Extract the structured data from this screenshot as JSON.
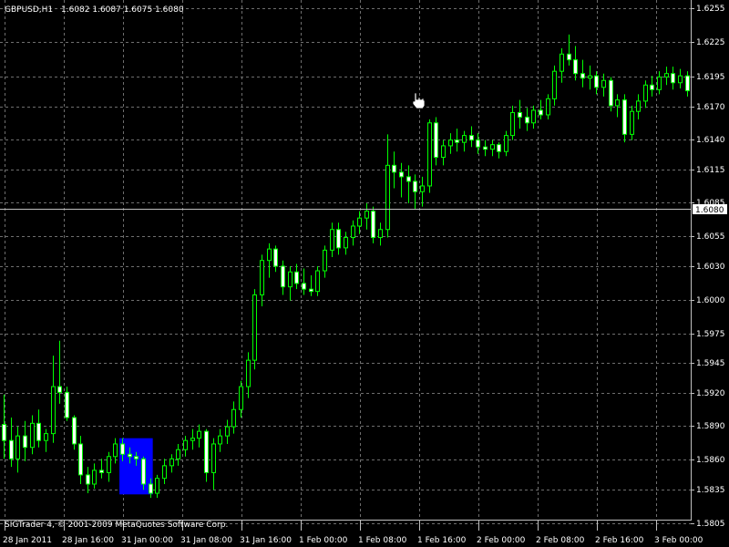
{
  "header": {
    "symbol": "GBPUSD,H1",
    "ohlc": "1.6082 1.6087 1.6075 1.6080"
  },
  "footer": {
    "copyright": "SIGTrader 4, © 2001-2009 MetaQuotes Software Corp."
  },
  "colors": {
    "background": "#000000",
    "grid": "#6e6e6e",
    "candle": "#00ff00",
    "bear_body": "#ffffff",
    "highlight": "#0000ff",
    "price_line": "#c0c0c0"
  },
  "chart_data": {
    "type": "candlestick",
    "title": "GBPUSD,H1",
    "ylim": [
      1.5805,
      1.6255
    ],
    "y_ticks": [
      "1.6255",
      "1.6225",
      "1.6195",
      "1.6170",
      "1.6140",
      "1.6115",
      "1.6085",
      "1.6055",
      "1.6030",
      "1.6000",
      "1.5975",
      "1.5945",
      "1.5920",
      "1.5890",
      "1.5860",
      "1.5835",
      "1.5805"
    ],
    "current_price": "1.6080",
    "x_ticks": [
      "28 Jan 2011",
      "28 Jan 16:00",
      "31 Jan 00:00",
      "31 Jan 08:00",
      "31 Jan 16:00",
      "1 Feb 00:00",
      "1 Feb 08:00",
      "1 Feb 16:00",
      "2 Feb 00:00",
      "2 Feb 08:00",
      "2 Feb 16:00",
      "3 Feb 00:00"
    ],
    "highlight_range": {
      "from_bar": 17,
      "to_bar": 21,
      "low": 1.5831,
      "high": 1.588
    },
    "candles": [
      {
        "o": 1.5892,
        "h": 1.5918,
        "l": 1.5862,
        "c": 1.5878
      },
      {
        "o": 1.5878,
        "h": 1.5898,
        "l": 1.5855,
        "c": 1.5862
      },
      {
        "o": 1.5862,
        "h": 1.589,
        "l": 1.585,
        "c": 1.5882
      },
      {
        "o": 1.5882,
        "h": 1.5895,
        "l": 1.586,
        "c": 1.5872
      },
      {
        "o": 1.5872,
        "h": 1.59,
        "l": 1.5866,
        "c": 1.5893
      },
      {
        "o": 1.5893,
        "h": 1.5905,
        "l": 1.5872,
        "c": 1.5878
      },
      {
        "o": 1.5878,
        "h": 1.5888,
        "l": 1.5868,
        "c": 1.5884
      },
      {
        "o": 1.5884,
        "h": 1.5952,
        "l": 1.5876,
        "c": 1.5925
      },
      {
        "o": 1.5925,
        "h": 1.5965,
        "l": 1.591,
        "c": 1.592
      },
      {
        "o": 1.592,
        "h": 1.5925,
        "l": 1.5895,
        "c": 1.5898
      },
      {
        "o": 1.5898,
        "h": 1.59,
        "l": 1.587,
        "c": 1.5875
      },
      {
        "o": 1.5875,
        "h": 1.5882,
        "l": 1.584,
        "c": 1.5848
      },
      {
        "o": 1.5848,
        "h": 1.5855,
        "l": 1.5832,
        "c": 1.584
      },
      {
        "o": 1.584,
        "h": 1.5858,
        "l": 1.5836,
        "c": 1.5852
      },
      {
        "o": 1.5852,
        "h": 1.5862,
        "l": 1.5845,
        "c": 1.585
      },
      {
        "o": 1.585,
        "h": 1.5868,
        "l": 1.5842,
        "c": 1.5864
      },
      {
        "o": 1.5864,
        "h": 1.588,
        "l": 1.5858,
        "c": 1.5875
      },
      {
        "o": 1.5875,
        "h": 1.588,
        "l": 1.586,
        "c": 1.5866
      },
      {
        "o": 1.5866,
        "h": 1.5872,
        "l": 1.5858,
        "c": 1.5864
      },
      {
        "o": 1.5864,
        "h": 1.5868,
        "l": 1.5856,
        "c": 1.5862
      },
      {
        "o": 1.5862,
        "h": 1.5864,
        "l": 1.5835,
        "c": 1.584
      },
      {
        "o": 1.584,
        "h": 1.5845,
        "l": 1.5828,
        "c": 1.5832
      },
      {
        "o": 1.5832,
        "h": 1.5848,
        "l": 1.5828,
        "c": 1.5845
      },
      {
        "o": 1.5845,
        "h": 1.5862,
        "l": 1.584,
        "c": 1.5856
      },
      {
        "o": 1.5856,
        "h": 1.5866,
        "l": 1.585,
        "c": 1.5862
      },
      {
        "o": 1.5862,
        "h": 1.5875,
        "l": 1.5856,
        "c": 1.587
      },
      {
        "o": 1.587,
        "h": 1.5882,
        "l": 1.5864,
        "c": 1.5878
      },
      {
        "o": 1.5878,
        "h": 1.5888,
        "l": 1.587,
        "c": 1.588
      },
      {
        "o": 1.588,
        "h": 1.5892,
        "l": 1.5872,
        "c": 1.5886
      },
      {
        "o": 1.5886,
        "h": 1.5888,
        "l": 1.5842,
        "c": 1.585
      },
      {
        "o": 1.585,
        "h": 1.588,
        "l": 1.5835,
        "c": 1.5875
      },
      {
        "o": 1.5875,
        "h": 1.5888,
        "l": 1.5868,
        "c": 1.5882
      },
      {
        "o": 1.5882,
        "h": 1.5896,
        "l": 1.5875,
        "c": 1.589
      },
      {
        "o": 1.589,
        "h": 1.5912,
        "l": 1.5884,
        "c": 1.5905
      },
      {
        "o": 1.5905,
        "h": 1.593,
        "l": 1.5898,
        "c": 1.5925
      },
      {
        "o": 1.5925,
        "h": 1.5955,
        "l": 1.5915,
        "c": 1.5948
      },
      {
        "o": 1.5948,
        "h": 1.601,
        "l": 1.594,
        "c": 1.6005
      },
      {
        "o": 1.6005,
        "h": 1.604,
        "l": 1.5995,
        "c": 1.6035
      },
      {
        "o": 1.6035,
        "h": 1.605,
        "l": 1.602,
        "c": 1.6045
      },
      {
        "o": 1.6045,
        "h": 1.6048,
        "l": 1.6025,
        "c": 1.603
      },
      {
        "o": 1.603,
        "h": 1.6035,
        "l": 1.6005,
        "c": 1.6012
      },
      {
        "o": 1.6012,
        "h": 1.603,
        "l": 1.6,
        "c": 1.6025
      },
      {
        "o": 1.6025,
        "h": 1.6032,
        "l": 1.601,
        "c": 1.6015
      },
      {
        "o": 1.6015,
        "h": 1.6028,
        "l": 1.6005,
        "c": 1.601
      },
      {
        "o": 1.601,
        "h": 1.6022,
        "l": 1.6004,
        "c": 1.6008
      },
      {
        "o": 1.6008,
        "h": 1.603,
        "l": 1.6004,
        "c": 1.6026
      },
      {
        "o": 1.6026,
        "h": 1.6048,
        "l": 1.602,
        "c": 1.6044
      },
      {
        "o": 1.6044,
        "h": 1.6068,
        "l": 1.6038,
        "c": 1.6062
      },
      {
        "o": 1.6062,
        "h": 1.6068,
        "l": 1.604,
        "c": 1.6046
      },
      {
        "o": 1.6046,
        "h": 1.606,
        "l": 1.604,
        "c": 1.6055
      },
      {
        "o": 1.6055,
        "h": 1.607,
        "l": 1.6048,
        "c": 1.6065
      },
      {
        "o": 1.6065,
        "h": 1.6078,
        "l": 1.6058,
        "c": 1.6072
      },
      {
        "o": 1.6072,
        "h": 1.6085,
        "l": 1.6062,
        "c": 1.6078
      },
      {
        "o": 1.6078,
        "h": 1.6082,
        "l": 1.605,
        "c": 1.6055
      },
      {
        "o": 1.6055,
        "h": 1.6068,
        "l": 1.6048,
        "c": 1.6062
      },
      {
        "o": 1.6062,
        "h": 1.6145,
        "l": 1.6055,
        "c": 1.6118
      },
      {
        "o": 1.6118,
        "h": 1.613,
        "l": 1.6098,
        "c": 1.6112
      },
      {
        "o": 1.6112,
        "h": 1.612,
        "l": 1.609,
        "c": 1.6108
      },
      {
        "o": 1.6108,
        "h": 1.6118,
        "l": 1.6085,
        "c": 1.6104
      },
      {
        "o": 1.6104,
        "h": 1.611,
        "l": 1.608,
        "c": 1.6095
      },
      {
        "o": 1.6095,
        "h": 1.6108,
        "l": 1.6082,
        "c": 1.61
      },
      {
        "o": 1.61,
        "h": 1.6158,
        "l": 1.6094,
        "c": 1.6155
      },
      {
        "o": 1.6155,
        "h": 1.616,
        "l": 1.6118,
        "c": 1.6125
      },
      {
        "o": 1.6125,
        "h": 1.614,
        "l": 1.6118,
        "c": 1.6135
      },
      {
        "o": 1.6135,
        "h": 1.6146,
        "l": 1.6128,
        "c": 1.614
      },
      {
        "o": 1.614,
        "h": 1.615,
        "l": 1.613,
        "c": 1.6138
      },
      {
        "o": 1.6138,
        "h": 1.6148,
        "l": 1.613,
        "c": 1.6144
      },
      {
        "o": 1.6144,
        "h": 1.6152,
        "l": 1.6134,
        "c": 1.614
      },
      {
        "o": 1.614,
        "h": 1.6146,
        "l": 1.6128,
        "c": 1.6134
      },
      {
        "o": 1.6134,
        "h": 1.614,
        "l": 1.6126,
        "c": 1.6132
      },
      {
        "o": 1.6132,
        "h": 1.614,
        "l": 1.6126,
        "c": 1.6136
      },
      {
        "o": 1.6136,
        "h": 1.6138,
        "l": 1.6124,
        "c": 1.613
      },
      {
        "o": 1.613,
        "h": 1.6148,
        "l": 1.6126,
        "c": 1.6144
      },
      {
        "o": 1.6144,
        "h": 1.617,
        "l": 1.614,
        "c": 1.6164
      },
      {
        "o": 1.6164,
        "h": 1.6175,
        "l": 1.615,
        "c": 1.616
      },
      {
        "o": 1.616,
        "h": 1.6168,
        "l": 1.6148,
        "c": 1.6155
      },
      {
        "o": 1.6155,
        "h": 1.617,
        "l": 1.615,
        "c": 1.6166
      },
      {
        "o": 1.6166,
        "h": 1.6175,
        "l": 1.6158,
        "c": 1.6162
      },
      {
        "o": 1.6162,
        "h": 1.618,
        "l": 1.6158,
        "c": 1.6176
      },
      {
        "o": 1.6176,
        "h": 1.6205,
        "l": 1.617,
        "c": 1.62
      },
      {
        "o": 1.62,
        "h": 1.622,
        "l": 1.619,
        "c": 1.6215
      },
      {
        "o": 1.6215,
        "h": 1.6232,
        "l": 1.6205,
        "c": 1.621
      },
      {
        "o": 1.621,
        "h": 1.6222,
        "l": 1.6192,
        "c": 1.6198
      },
      {
        "o": 1.6198,
        "h": 1.621,
        "l": 1.6186,
        "c": 1.6194
      },
      {
        "o": 1.6194,
        "h": 1.6205,
        "l": 1.6184,
        "c": 1.6196
      },
      {
        "o": 1.6196,
        "h": 1.62,
        "l": 1.618,
        "c": 1.6186
      },
      {
        "o": 1.6186,
        "h": 1.6198,
        "l": 1.6178,
        "c": 1.6192
      },
      {
        "o": 1.6192,
        "h": 1.6195,
        "l": 1.6165,
        "c": 1.617
      },
      {
        "o": 1.617,
        "h": 1.618,
        "l": 1.616,
        "c": 1.6175
      },
      {
        "o": 1.6175,
        "h": 1.618,
        "l": 1.6138,
        "c": 1.6145
      },
      {
        "o": 1.6145,
        "h": 1.617,
        "l": 1.614,
        "c": 1.6165
      },
      {
        "o": 1.6165,
        "h": 1.618,
        "l": 1.6158,
        "c": 1.6174
      },
      {
        "o": 1.6174,
        "h": 1.6192,
        "l": 1.6168,
        "c": 1.6188
      },
      {
        "o": 1.6188,
        "h": 1.6196,
        "l": 1.6178,
        "c": 1.6184
      },
      {
        "o": 1.6184,
        "h": 1.62,
        "l": 1.618,
        "c": 1.6195
      },
      {
        "o": 1.6195,
        "h": 1.6204,
        "l": 1.6188,
        "c": 1.6198
      },
      {
        "o": 1.6198,
        "h": 1.6204,
        "l": 1.6184,
        "c": 1.619
      },
      {
        "o": 1.619,
        "h": 1.6202,
        "l": 1.6185,
        "c": 1.6196
      },
      {
        "o": 1.6196,
        "h": 1.62,
        "l": 1.6178,
        "c": 1.6183
      }
    ]
  }
}
